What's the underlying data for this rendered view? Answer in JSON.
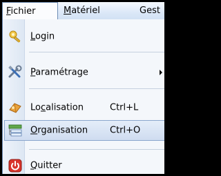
{
  "menubar": {
    "items": [
      {
        "label": "Fichier",
        "mnemonic": "F",
        "active": true
      },
      {
        "label": "Matériel",
        "mnemonic": "M"
      },
      {
        "label": "Gest",
        "mnemonic": ""
      }
    ]
  },
  "menu": {
    "items": [
      {
        "label": "Login",
        "icon": "user-key-icon",
        "mnemonic_index": 0
      },
      {
        "label": "Paramétrage",
        "icon": "tools-icon",
        "submenu": true
      },
      {
        "label": "Localisation",
        "icon": "location-icon",
        "shortcut": "Ctrl+L"
      },
      {
        "label": "Organisation",
        "icon": "organisation-icon",
        "shortcut": "Ctrl+O",
        "highlighted": true
      },
      {
        "label": "Quitter",
        "icon": "power-icon"
      }
    ]
  },
  "colors": {
    "highlight_border": "#8aa6cc",
    "highlight_fill": "#d6e2f3",
    "menubar_bg": "#dce8f8"
  }
}
